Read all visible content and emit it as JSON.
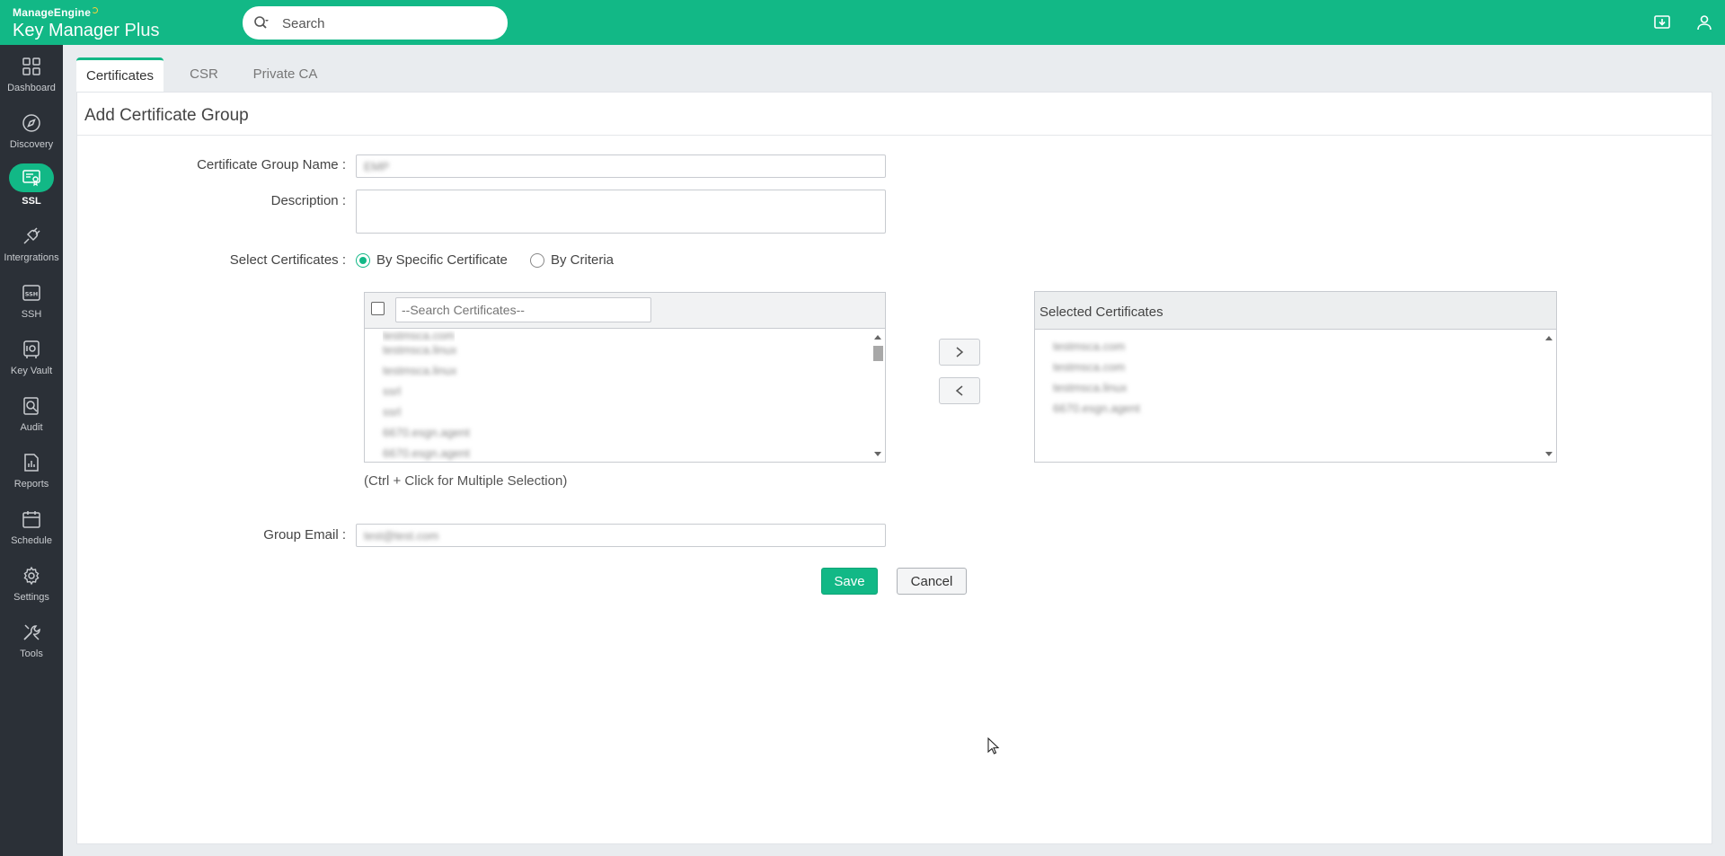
{
  "app": {
    "vendor": "ManageEngine",
    "product_main": "Key Manager",
    "product_suffix": "Plus"
  },
  "search": {
    "placeholder": "Search"
  },
  "sidebar": {
    "items": [
      {
        "label": "Dashboard",
        "icon": "dashboard-icon",
        "active": false
      },
      {
        "label": "Discovery",
        "icon": "compass-icon",
        "active": false
      },
      {
        "label": "SSL",
        "icon": "certificate-icon",
        "active": true
      },
      {
        "label": "Intergrations",
        "icon": "plug-icon",
        "active": false
      },
      {
        "label": "SSH",
        "icon": "ssh-icon",
        "active": false
      },
      {
        "label": "Key Vault",
        "icon": "vault-icon",
        "active": false
      },
      {
        "label": "Audit",
        "icon": "audit-icon",
        "active": false
      },
      {
        "label": "Reports",
        "icon": "reports-icon",
        "active": false
      },
      {
        "label": "Schedule",
        "icon": "calendar-icon",
        "active": false
      },
      {
        "label": "Settings",
        "icon": "gear-icon",
        "active": false
      },
      {
        "label": "Tools",
        "icon": "tools-icon",
        "active": false
      }
    ]
  },
  "tabs": [
    {
      "label": "Certificates",
      "active": true
    },
    {
      "label": "CSR",
      "active": false
    },
    {
      "label": "Private CA",
      "active": false
    }
  ],
  "form": {
    "title": "Add Certificate Group",
    "group_name_label": "Certificate Group Name :",
    "group_name_value": "EMP",
    "description_label": "Description :",
    "description_value": "",
    "select_label": "Select Certificates :",
    "radio_specific": "By Specific Certificate",
    "radio_criteria": "By Criteria",
    "selected_mode": "By Specific Certificate",
    "search_certs_placeholder": "--Search Certificates--",
    "available_certificates": [
      "testmsca.com",
      "testmsca.linux",
      "testmsca.linux",
      "ssrl",
      "ssrl",
      "6670.esgn.agent",
      "6670.esgn.agent"
    ],
    "selected_header": "Selected Certificates",
    "selected_certificates": [
      "testmsca.com",
      "testmsca.com",
      "testmsca.linux",
      "6670.esgn.agent"
    ],
    "hint": "(Ctrl + Click for Multiple Selection)",
    "email_label": "Group Email :",
    "email_value": "test@test.com",
    "save_label": "Save",
    "cancel_label": "Cancel"
  },
  "colors": {
    "brand": "#12b886",
    "sidebar_bg": "#2b3037"
  }
}
